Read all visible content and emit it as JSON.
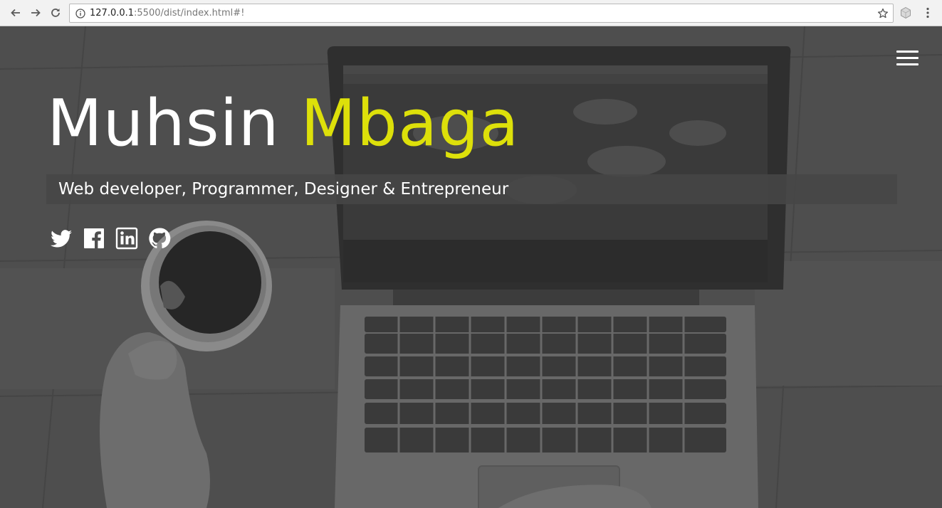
{
  "browser": {
    "url_host": "127.0.0.1",
    "url_rest": ":5500/dist/index.html#!"
  },
  "hero": {
    "first_name": "Muhsin",
    "last_name": "Mbaga",
    "tagline": "Web developer, Programmer, Designer & Entrepreneur"
  },
  "social": [
    {
      "icon": "twitter-icon"
    },
    {
      "icon": "facebook-icon"
    },
    {
      "icon": "linkedin-icon"
    },
    {
      "icon": "github-icon"
    }
  ],
  "colors": {
    "accent": "#dde00a",
    "text": "#ffffff",
    "overlay": "#4d4d4d"
  }
}
